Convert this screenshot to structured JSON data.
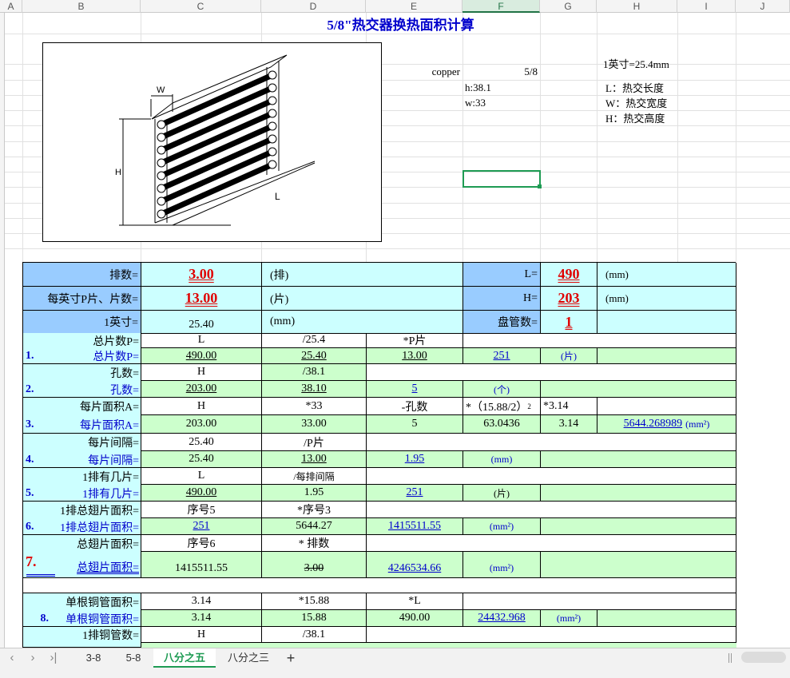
{
  "columns": [
    "A",
    "B",
    "C",
    "D",
    "E",
    "F",
    "G",
    "H",
    "I",
    "J"
  ],
  "selected_column": "F",
  "title": "5/8\"热交器换热面积计算",
  "info": {
    "copper": "copper",
    "copper_value": "5/8",
    "h": "h:38.1",
    "w": "w:33",
    "inch": "1英寸=25.4mm",
    "L_desc": "L：热交长度",
    "W_desc": "W：热交宽度",
    "H_desc": "H：热交高度"
  },
  "figure": {
    "label_w": "W",
    "label_h": "H",
    "label_l": "L"
  },
  "params": {
    "rows_label": "排数=",
    "rows_value": "3.00",
    "rows_unit": "(排)",
    "fpi_label": "每英寸P片、片数=",
    "fpi_value": "13.00",
    "fpi_unit": "(片)",
    "inch_label": "1英寸=",
    "inch_value": "25.40",
    "inch_unit": "(mm)",
    "L_label": "L=",
    "L_value": "490",
    "L_unit": "(mm)",
    "H_label": "H=",
    "H_value": "203",
    "H_unit": "(mm)",
    "coil_label": "盘管数=",
    "coil_value": "1"
  },
  "calc": {
    "r1a": {
      "label": "总片数P=",
      "c": "L",
      "d": "/25.4",
      "e": "*P片"
    },
    "r1b": {
      "num": "1.",
      "label": "总片数P=",
      "c": "490.00",
      "d": "25.40",
      "e": "13.00",
      "f": "251",
      "g": "(片)"
    },
    "r2a": {
      "label": "孔数=",
      "c": "H",
      "d": "/38.1"
    },
    "r2b": {
      "num": "2.",
      "label": "孔数=",
      "c": "203.00",
      "d": "38.10",
      "e": "5",
      "f": "(个)"
    },
    "r3a": {
      "label": "每片面积A=",
      "c": "H",
      "d": "*33",
      "e": "-孔数",
      "f": "*（15.88/2）",
      "f_sup": "2",
      "g": "*3.14"
    },
    "r3b": {
      "num": "3.",
      "label": "每片面积A=",
      "c": "203.00",
      "d": "33.00",
      "e": "5",
      "f": "63.0436",
      "g": "3.14",
      "h": "5644.268989",
      "h_unit": "(mm²)"
    },
    "r4a": {
      "label": "每片间隔=",
      "c": "25.40",
      "d": "/P片"
    },
    "r4b": {
      "num": "4.",
      "label": "每片间隔=",
      "c": "25.40",
      "d": "13.00",
      "e": "1.95",
      "f": "(mm)"
    },
    "r5a": {
      "label": "1排有几片=",
      "c": "L",
      "d": "/每排间隔"
    },
    "r5b": {
      "num": "5.",
      "label": "1排有几片=",
      "c": "490.00",
      "d": "1.95",
      "e": "251",
      "f": "(片)"
    },
    "r6a": {
      "label": "1排总翅片面积=",
      "c": "序号5",
      "d": "*序号3"
    },
    "r6b": {
      "num": "6.",
      "label": "1排总翅片面积=",
      "c": "251",
      "d": "5644.27",
      "e": "1415511.55",
      "f": "(mm²)"
    },
    "r7a": {
      "label": "总翅片面积=",
      "c": "序号6",
      "d": "* 排数"
    },
    "r7b": {
      "num": "7.",
      "label": "总翅片面积=",
      "c": "1415511.55",
      "d": "3.00",
      "e": "4246534.66",
      "f": "(mm²)"
    },
    "r8a": {
      "label": "单根铜管面积=",
      "c": "3.14",
      "d": "*15.88",
      "e": "*L"
    },
    "r8b": {
      "num": "8.",
      "label": "单根铜管面积=",
      "c": "3.14",
      "d": "15.88",
      "e": "490.00",
      "f": "24432.968",
      "g": "(mm²)"
    },
    "r9a": {
      "label": "1排铜管数=",
      "c": "H",
      "d": "/38.1"
    }
  },
  "tabs": [
    "3-8",
    "5-8",
    "八分之五",
    "八分之三"
  ],
  "active_tab": "八分之五",
  "add_tab": "+"
}
